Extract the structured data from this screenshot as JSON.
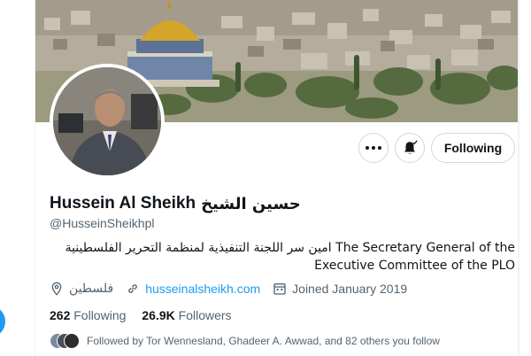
{
  "header": {
    "more_icon": "more-horizontal-icon",
    "bell_icon": "bell-subscribed-icon",
    "following_label": "Following"
  },
  "profile": {
    "name": "Hussein Al Sheikh",
    "name_arabic": "حسين الشيخ",
    "handle": "@HusseinSheikhpl",
    "bio_line1": "امين سر اللجنة التنفيذية لمنظمة التحرير الفلسطينية The Secretary General of the",
    "bio_line2": "Executive Committee of the PLO"
  },
  "meta": {
    "location": "فلسطين",
    "website": "husseinalsheikh.com",
    "joined": "Joined January 2019",
    "location_icon": "location-pin-icon",
    "link_icon": "link-icon",
    "calendar_icon": "calendar-icon"
  },
  "counts": {
    "following_value": "262",
    "following_label": "Following",
    "followers_value": "26.9K",
    "followers_label": "Followers"
  },
  "followed_by": "Followed by Tor Wennesland, Ghadeer A. Awwad, and 82 others you follow",
  "colors": {
    "accent": "#1d9bf0",
    "text_primary": "#0f1419",
    "text_secondary": "#536471",
    "border": "#cfd9de"
  }
}
